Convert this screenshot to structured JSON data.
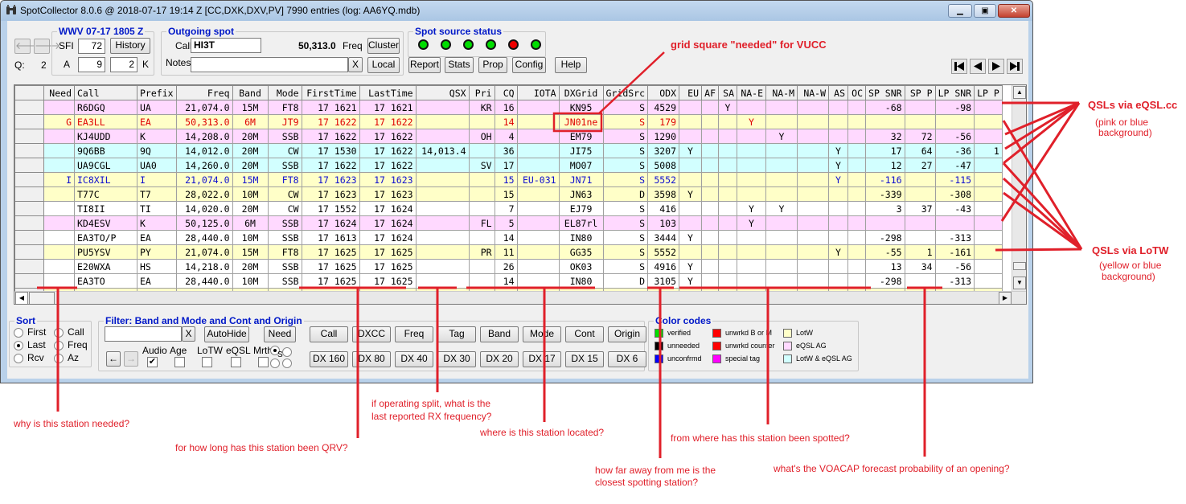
{
  "window": {
    "title": "SpotCollector 8.0.6 @ 2018-07-17  19:14 Z [CC,DXK,DXV,PV] 7990 entries (log: AA6YQ.mdb)",
    "icon": "binoculars-icon",
    "controls": {
      "minimize": "—",
      "maximize": "□",
      "close": "✕"
    }
  },
  "wwv": {
    "title": "WWV 07-17 1805 Z",
    "sfi_label": "SFI",
    "sfi": "72",
    "history_label": "History",
    "a_label": "A",
    "a": "9",
    "k_label": "K",
    "k": "2"
  },
  "queue": {
    "label": "Q:",
    "value": "2"
  },
  "outgoing": {
    "title": "Outgoing spot",
    "call_label": "Call",
    "call": "HI3T",
    "freq_value": "50,313.0",
    "freq_label": "Freq",
    "cluster_label": "Cluster",
    "notes_label": "Notes",
    "notes": "",
    "clear_label": "X",
    "local_label": "Local"
  },
  "spot_source": {
    "title": "Spot source status",
    "leds": [
      "#00dd00",
      "#00dd00",
      "#00dd00",
      "#00dd00",
      "#ee0000",
      "#00dd00"
    ],
    "buttons": [
      "Report",
      "Stats",
      "Prop",
      "Config"
    ]
  },
  "help_label": "Help",
  "columns": [
    "",
    "Need",
    "Call",
    "Prefix",
    "Freq",
    "Band",
    "Mode",
    "FirstTime",
    "LastTime",
    "QSX",
    "Pri",
    "CQ",
    "IOTA",
    "DXGrid",
    "GridSrc",
    "ODX",
    "EU",
    "AF",
    "SA",
    "NA-E",
    "NA-M",
    "NA-W",
    "AS",
    "OC",
    "SP SNR",
    "SP P",
    "LP SNR",
    "LP P"
  ],
  "rows": [
    {
      "bg": "pink",
      "text": "black",
      "cells": [
        "",
        "",
        "R6DGQ",
        "UA",
        "21,074.0",
        "15M",
        "FT8",
        "17 1621",
        "17 1621",
        "",
        "KR",
        "16",
        "",
        "KN95",
        "S",
        "4529",
        "",
        "",
        "Y",
        "",
        "",
        "",
        "",
        "",
        "-68",
        "",
        "-98",
        ""
      ]
    },
    {
      "bg": "yellow",
      "text": "red",
      "cells": [
        "",
        "G",
        "EA3LL",
        "EA",
        "50,313.0",
        "6M",
        "JT9",
        "17 1622",
        "17 1622",
        "",
        "",
        "14",
        "",
        "JN01ne",
        "S",
        "179",
        "",
        "",
        "",
        "Y",
        "",
        "",
        "",
        "",
        "",
        "",
        "",
        ""
      ]
    },
    {
      "bg": "pink",
      "text": "black",
      "cells": [
        "",
        "",
        "KJ4UDD",
        "K",
        "14,208.0",
        "20M",
        "SSB",
        "17 1622",
        "17 1622",
        "",
        "OH",
        "4",
        "",
        "EM79",
        "S",
        "1290",
        "",
        "",
        "",
        "",
        "Y",
        "",
        "",
        "",
        "32",
        "72",
        "-56",
        ""
      ]
    },
    {
      "bg": "blue",
      "text": "black",
      "cells": [
        "",
        "",
        "9Q6BB",
        "9Q",
        "14,012.0",
        "20M",
        "CW",
        "17 1530",
        "17 1622",
        "14,013.4",
        "",
        "36",
        "",
        "JI75",
        "S",
        "3207",
        "Y",
        "",
        "",
        "",
        "",
        "",
        "Y",
        "",
        "17",
        "64",
        "-36",
        "1"
      ]
    },
    {
      "bg": "blue",
      "text": "black",
      "cells": [
        "",
        "",
        "UA9CGL",
        "UA0",
        "14,260.0",
        "20M",
        "SSB",
        "17 1622",
        "17 1622",
        "",
        "SV",
        "17",
        "",
        "MO07",
        "S",
        "5008",
        "",
        "",
        "",
        "",
        "",
        "",
        "Y",
        "",
        "12",
        "27",
        "-47",
        ""
      ]
    },
    {
      "bg": "yellow",
      "text": "blue",
      "cells": [
        "",
        "I",
        "IC8XIL",
        "I",
        "21,074.0",
        "15M",
        "FT8",
        "17 1623",
        "17 1623",
        "",
        "",
        "15",
        "EU-031",
        "JN71",
        "S",
        "5552",
        "",
        "",
        "",
        "",
        "",
        "",
        "Y",
        "",
        "-116",
        "",
        "-115",
        ""
      ]
    },
    {
      "bg": "yellow",
      "text": "black",
      "cells": [
        "",
        "",
        "T77C",
        "T7",
        "28,022.0",
        "10M",
        "CW",
        "17 1623",
        "17 1623",
        "",
        "",
        "15",
        "",
        "JN63",
        "D",
        "3598",
        "Y",
        "",
        "",
        "",
        "",
        "",
        "",
        "",
        "-339",
        "",
        "-308",
        ""
      ]
    },
    {
      "bg": "white",
      "text": "black",
      "cells": [
        "",
        "",
        "TI8II",
        "TI",
        "14,020.0",
        "20M",
        "CW",
        "17 1552",
        "17 1624",
        "",
        "",
        "7",
        "",
        "EJ79",
        "S",
        "416",
        "",
        "",
        "",
        "Y",
        "Y",
        "",
        "",
        "",
        "3",
        "37",
        "-43",
        ""
      ]
    },
    {
      "bg": "pink",
      "text": "black",
      "cells": [
        "",
        "",
        "KD4ESV",
        "K",
        "50,125.0",
        "6M",
        "SSB",
        "17 1624",
        "17 1624",
        "",
        "FL",
        "5",
        "",
        "EL87rl",
        "S",
        "103",
        "",
        "",
        "",
        "Y",
        "",
        "",
        "",
        "",
        "",
        "",
        "",
        ""
      ]
    },
    {
      "bg": "white",
      "text": "black",
      "cells": [
        "",
        "",
        "EA3TO/P",
        "EA",
        "28,440.0",
        "10M",
        "SSB",
        "17 1613",
        "17 1624",
        "",
        "",
        "14",
        "",
        "IN80",
        "S",
        "3444",
        "Y",
        "",
        "",
        "",
        "",
        "",
        "",
        "",
        "-298",
        "",
        "-313",
        ""
      ]
    },
    {
      "bg": "yellow",
      "text": "black",
      "cells": [
        "",
        "",
        "PU5YSV",
        "PY",
        "21,074.0",
        "15M",
        "FT8",
        "17 1625",
        "17 1625",
        "",
        "PR",
        "11",
        "",
        "GG35",
        "S",
        "5552",
        "",
        "",
        "",
        "",
        "",
        "",
        "Y",
        "",
        "-55",
        "1",
        "-161",
        ""
      ]
    },
    {
      "bg": "white",
      "text": "black",
      "cells": [
        "",
        "",
        "E20WXA",
        "HS",
        "14,218.0",
        "20M",
        "SSB",
        "17 1625",
        "17 1625",
        "",
        "",
        "26",
        "",
        "OK03",
        "S",
        "4916",
        "Y",
        "",
        "",
        "",
        "",
        "",
        "",
        "",
        "13",
        "34",
        "-56",
        ""
      ]
    },
    {
      "bg": "white",
      "text": "black",
      "cells": [
        "",
        "",
        "EA3TO",
        "EA",
        "28,440.0",
        "10M",
        "SSB",
        "17 1625",
        "17 1625",
        "",
        "",
        "14",
        "",
        "IN80",
        "D",
        "3105",
        "Y",
        "",
        "",
        "",
        "",
        "",
        "",
        "",
        "-298",
        "",
        "-313",
        ""
      ]
    }
  ],
  "sort": {
    "title": "Sort",
    "options": [
      {
        "label": "First",
        "checked": false
      },
      {
        "label": "Call",
        "checked": false
      },
      {
        "label": "Last",
        "checked": true
      },
      {
        "label": "Freq",
        "checked": false
      },
      {
        "label": "Rcv",
        "checked": false
      },
      {
        "label": "Az",
        "checked": false
      }
    ]
  },
  "filter": {
    "title": "Filter: Band and Mode and Cont and Origin",
    "input": "",
    "clear_label": "X",
    "autohide_label": "AutoHide",
    "need_label": "Need",
    "checks": [
      {
        "label": "Audio",
        "checked": true
      },
      {
        "label": "Age",
        "checked": false
      },
      {
        "label": "LoTW",
        "checked": false
      },
      {
        "label": "eQSL",
        "checked": false
      },
      {
        "label": "Mrthn",
        "checked": false
      }
    ],
    "s_label": "S",
    "row1": [
      "Call",
      "DXCC",
      "Freq",
      "Tag",
      "Band",
      "Mode",
      "Cont",
      "Origin"
    ],
    "row2": [
      "DX 160",
      "DX 80",
      "DX 40",
      "DX 30",
      "DX 20",
      "DX 17",
      "DX 15",
      "DX 6"
    ]
  },
  "color_codes": {
    "title": "Color codes",
    "items": [
      {
        "label": "verified",
        "color": "#00e000"
      },
      {
        "label": "unneeded",
        "color": "#000000"
      },
      {
        "label": "unconfrmd",
        "color": "#0000ff"
      },
      {
        "label": "unwrkd B or M",
        "color": "#ff0000"
      },
      {
        "label": "unwrkd counter",
        "color": "#ff0000"
      },
      {
        "label": "special tag",
        "color": "#ff00ff"
      },
      {
        "label": "LotW",
        "color": "#ffffc8"
      },
      {
        "label": "eQSL AG",
        "color": "#ffd9ff"
      },
      {
        "label": "LotW & eQSL AG",
        "color": "#d2ffff"
      }
    ]
  },
  "annotations": {
    "grid_needed": "grid square \"needed\" for VUCC",
    "eqsl_title": "QSLs via eQSL.cc",
    "eqsl_sub1": "(pink or blue",
    "eqsl_sub2": "background)",
    "lotw_title": "QSLs via LoTW",
    "lotw_sub1": "(yellow or blue",
    "lotw_sub2": "background)",
    "why_needed": "why is this station needed?",
    "how_long": "for how long has this station been QRV?",
    "split_1": "if operating split, what is the",
    "split_2": "last reported RX frequency?",
    "where_located": "where is this station located?",
    "how_far_1": "how far away from me is the",
    "how_far_2": "closest spotting station?",
    "from_where": "from where has this station been spotted?",
    "voacap": "what's the VOACAP forecast probability of an opening?"
  }
}
